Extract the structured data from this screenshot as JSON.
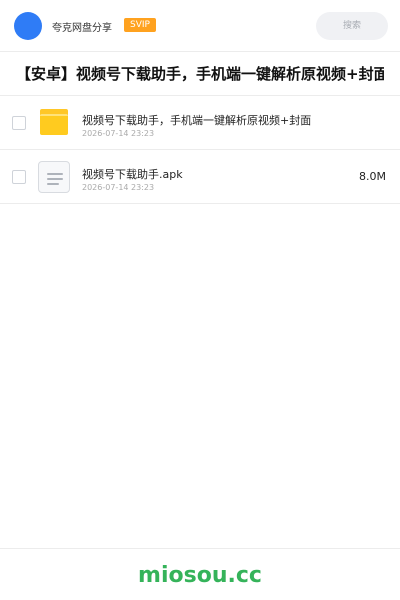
{
  "header": {
    "account_name": "夸克网盘分享",
    "badge": "SVIP",
    "search_placeholder": "搜索",
    "brand_color": "#2f7cf6",
    "badge_color": "#ffa21f"
  },
  "share": {
    "title": "【安卓】视频号下载助手，手机端一键解析原视频+封面"
  },
  "files": [
    {
      "icon": "folder-icon",
      "name": "视频号下载助手，手机端一键解析原视频+封面",
      "date": "2026-07-14 23:23",
      "size": ""
    },
    {
      "icon": "document-icon",
      "name": "视频号下载助手.apk",
      "date": "2026-07-14 23:23",
      "size": "8.0M"
    }
  ],
  "footer": {
    "watermark": "miosou.cc",
    "watermark_color": "#35b35a"
  }
}
